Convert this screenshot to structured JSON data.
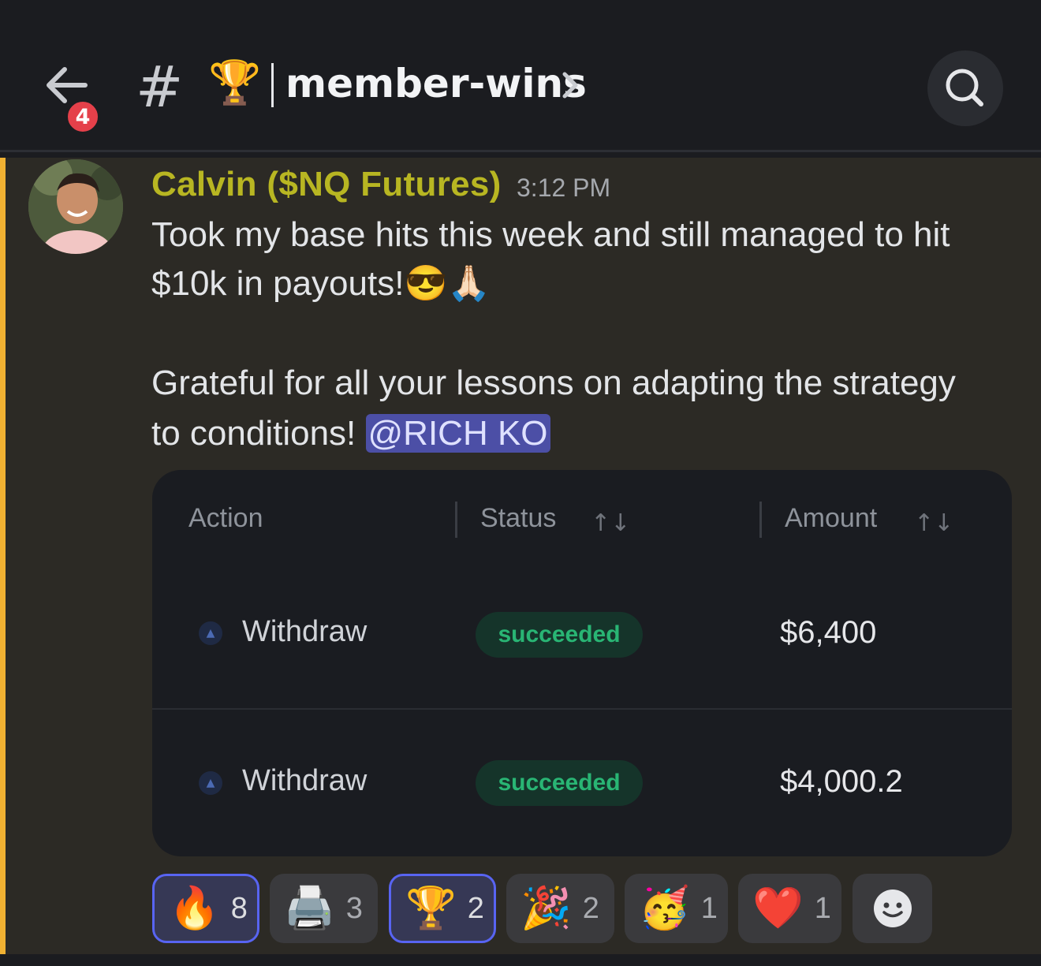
{
  "header": {
    "back_badge": "4",
    "channel_hash": "#",
    "channel_emoji": "🏆",
    "channel_name": "member-wins",
    "chevron_icon": "chevron-right-icon",
    "search_icon": "search-icon"
  },
  "message": {
    "author": "Calvin ($NQ Futures)",
    "time": "3:12 PM",
    "line1": "Took my base hits this week and still managed to hit",
    "line2": "$10k in payouts!😎🙏🏻",
    "line3": "Grateful for all your lessons on adapting the strategy",
    "line4_prefix": "to conditions! ",
    "mention": "@RICH KO"
  },
  "embed": {
    "columns": [
      "Action",
      "Status",
      "Amount"
    ],
    "rows": [
      {
        "action": "Withdraw",
        "status": "succeeded",
        "amount": "$6,400"
      },
      {
        "action": "Withdraw",
        "status": "succeeded",
        "amount": "$4,000.2"
      }
    ]
  },
  "reactions": [
    {
      "emoji": "🔥",
      "count": "8",
      "active": true
    },
    {
      "emoji": "🖨️",
      "count": "3",
      "active": false
    },
    {
      "emoji": "🏆",
      "count": "2",
      "active": true
    },
    {
      "emoji": "🎉",
      "count": "2",
      "active": false
    },
    {
      "emoji": "🥳",
      "count": "1",
      "active": false
    },
    {
      "emoji": "❤️",
      "count": "1",
      "active": false
    }
  ],
  "add_reaction_icon": "smiley-icon",
  "colors": {
    "accent": "#5864f2",
    "author": "#b8b622",
    "highlight_bar": "#f0b132",
    "succeeded": "#29b574"
  }
}
